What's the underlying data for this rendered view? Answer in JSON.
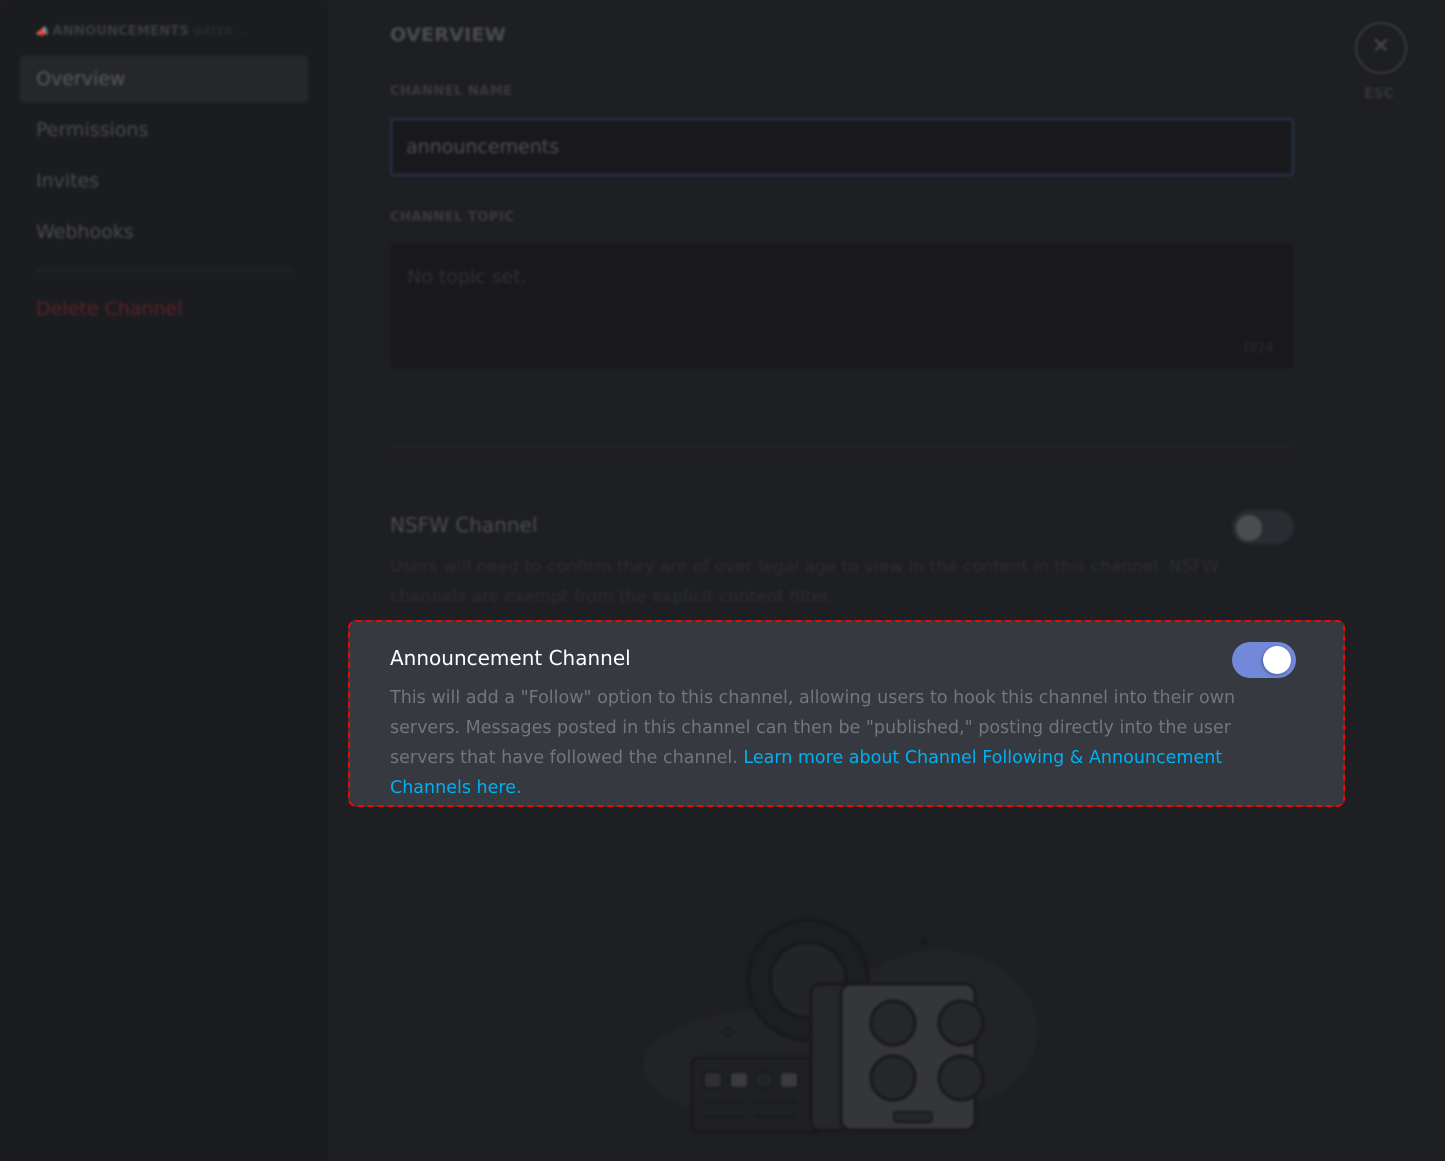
{
  "sidebar": {
    "heading": {
      "icon": "megaphone-icon",
      "channel": "ANNOUNCEMENTS",
      "category": "WATER ..."
    },
    "items": [
      {
        "label": "Overview",
        "active": true
      },
      {
        "label": "Permissions",
        "active": false
      },
      {
        "label": "Invites",
        "active": false
      },
      {
        "label": "Webhooks",
        "active": false
      }
    ],
    "delete_label": "Delete Channel"
  },
  "main": {
    "title": "OVERVIEW",
    "channel_name": {
      "label": "CHANNEL NAME",
      "value": "announcements"
    },
    "channel_topic": {
      "label": "CHANNEL TOPIC",
      "placeholder": "No topic set.",
      "char_limit": "1024"
    },
    "nsfw": {
      "title": "NSFW Channel",
      "description": "Users will need to confirm they are of over legal age to view in the content in this channel. NSFW channels are exempt from the explicit content filter.",
      "enabled": false
    },
    "announcement": {
      "title": "Announcement Channel",
      "description": "This will add a \"Follow\" option to this channel, allowing users to hook this channel into their own servers. Messages posted in this channel can then be \"published,\" posting directly into the user servers that have followed the channel.",
      "link": "Learn more about Channel Following & Announcement Channels here.",
      "enabled": true
    }
  },
  "close": {
    "icon": "close-icon",
    "label": "ESC"
  },
  "colors": {
    "accent": "#7289da",
    "link": "#00b0f4",
    "danger": "#f04747",
    "highlight_border": "#ff0000",
    "card_bg": "#36393f"
  }
}
